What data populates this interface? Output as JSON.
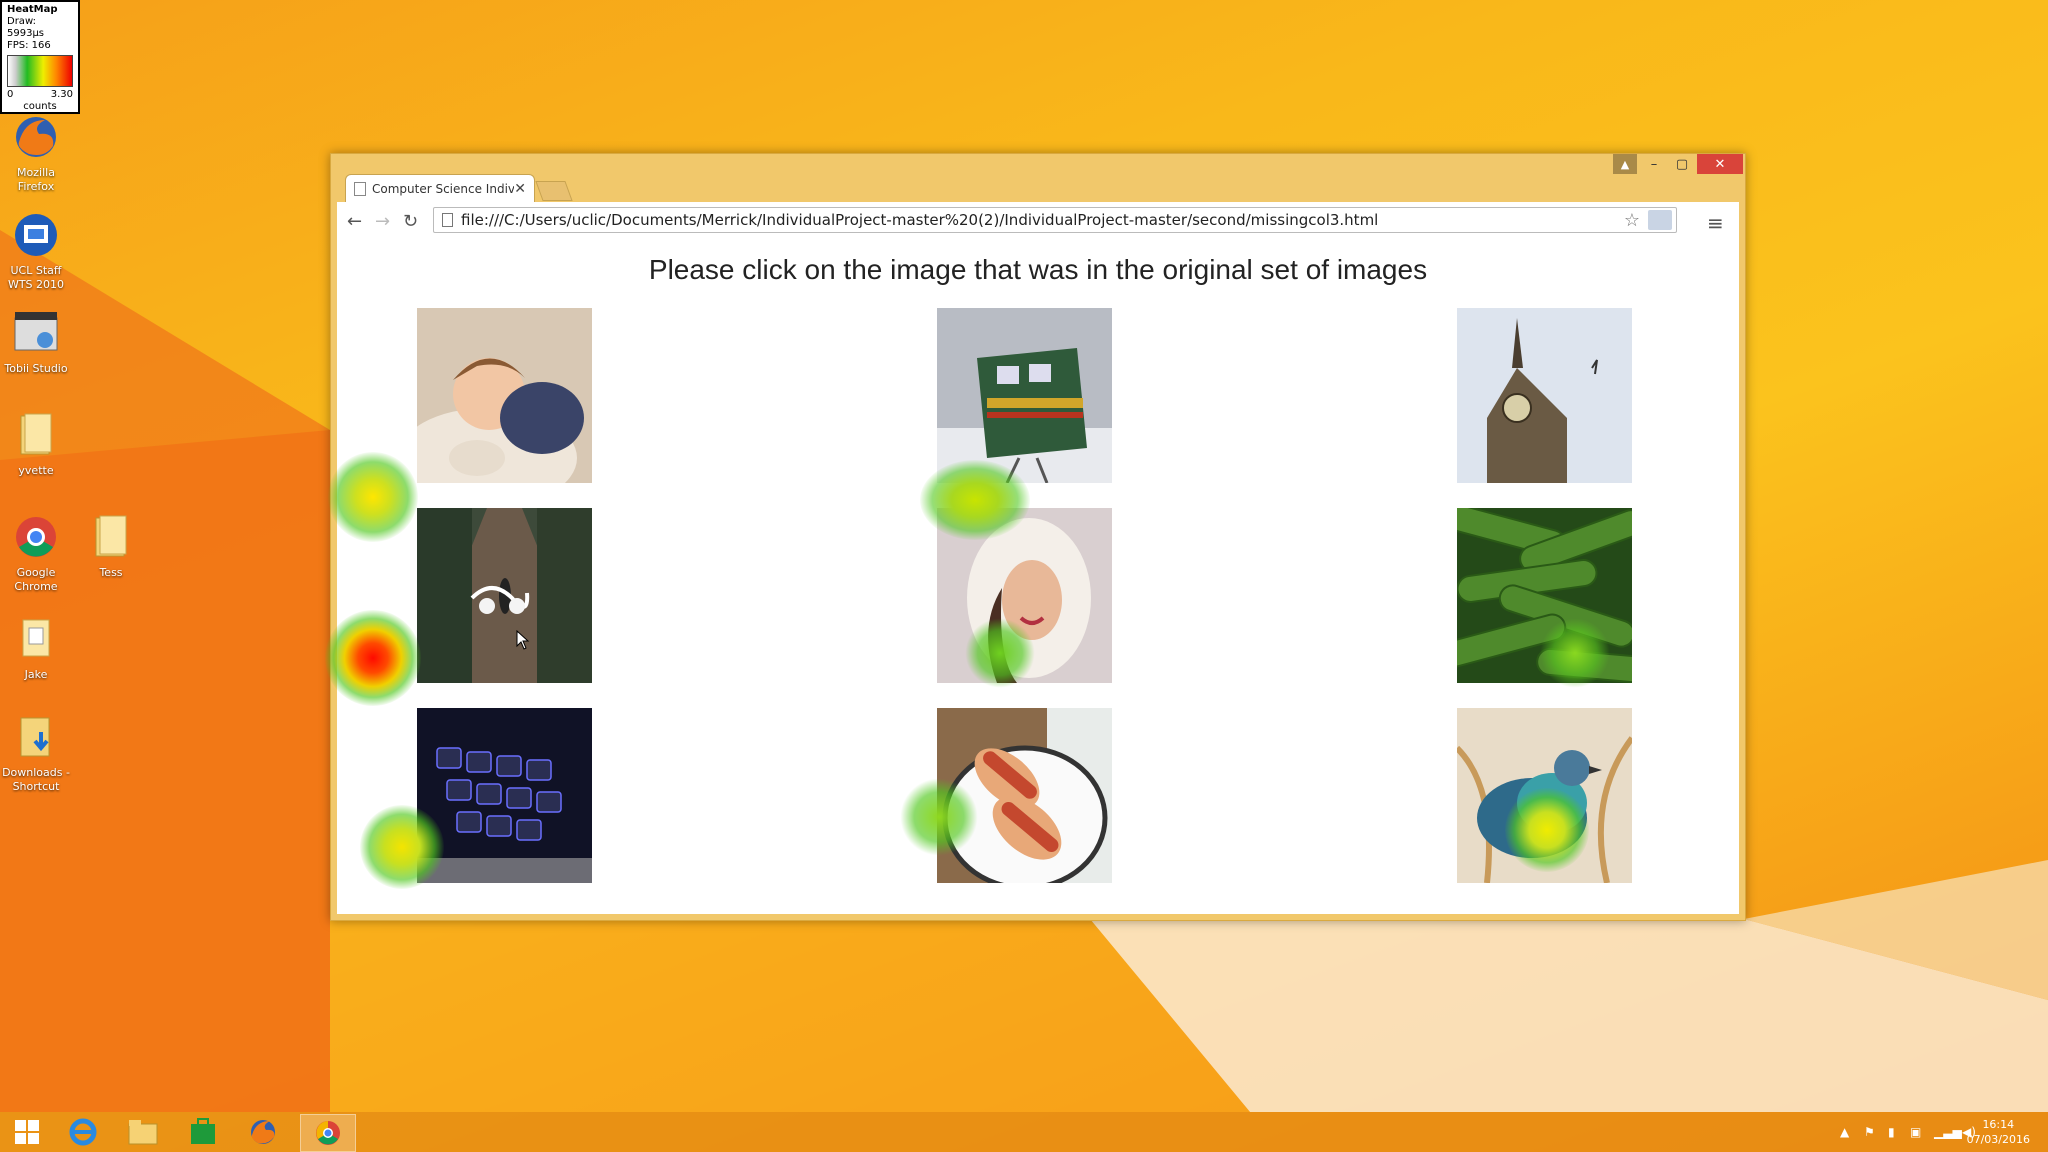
{
  "heatmap_panel": {
    "title": "HeatMap",
    "draw": "Draw: 5993µs",
    "fps": "FPS: 166",
    "min": "0",
    "max": "3.30",
    "unit": "counts"
  },
  "desktop_icons": [
    {
      "label": "Mozilla Firefox",
      "icon": "firefox-icon"
    },
    {
      "label": "UCL Staff WTS 2010",
      "icon": "remote-desktop-icon"
    },
    {
      "label": "Tobii Studio",
      "icon": "tobii-icon"
    },
    {
      "label": "yvette",
      "icon": "folder-icon"
    },
    {
      "label": "Google Chrome",
      "icon": "chrome-icon"
    },
    {
      "label": "Tess",
      "icon": "folder-icon"
    },
    {
      "label": "Jake",
      "icon": "document-icon"
    },
    {
      "label": "Downloads - Shortcut",
      "icon": "downloads-folder-icon"
    }
  ],
  "browser": {
    "tab_title": "Computer Science Individu",
    "url": "file:///C:/Users/uclic/Documents/Merrick/IndividualProject-master%20(2)/IndividualProject-master/second/missingcol3.html"
  },
  "page": {
    "heading": "Please click on the image that was in the original set of images",
    "images": [
      {
        "name": "sleeping-baby-image"
      },
      {
        "name": "green-locomotive-image"
      },
      {
        "name": "big-ben-image"
      },
      {
        "name": "earphones-on-path-image"
      },
      {
        "name": "woman-in-fur-hood-image"
      },
      {
        "name": "cucumbers-image"
      },
      {
        "name": "backlit-keyboard-image"
      },
      {
        "name": "hot-dogs-image"
      },
      {
        "name": "pigeon-image"
      }
    ]
  },
  "taskbar": {
    "items": [
      "start-icon",
      "internet-explorer-icon",
      "file-explorer-icon",
      "store-icon",
      "firefox-icon",
      "chrome-icon"
    ],
    "time": "16:14",
    "date": "07/03/2016"
  },
  "colors": {
    "desktop": "#f9b81a",
    "window_frame": "#f1c86b",
    "close_button": "#d9443a",
    "taskbar": "#e68c14"
  }
}
